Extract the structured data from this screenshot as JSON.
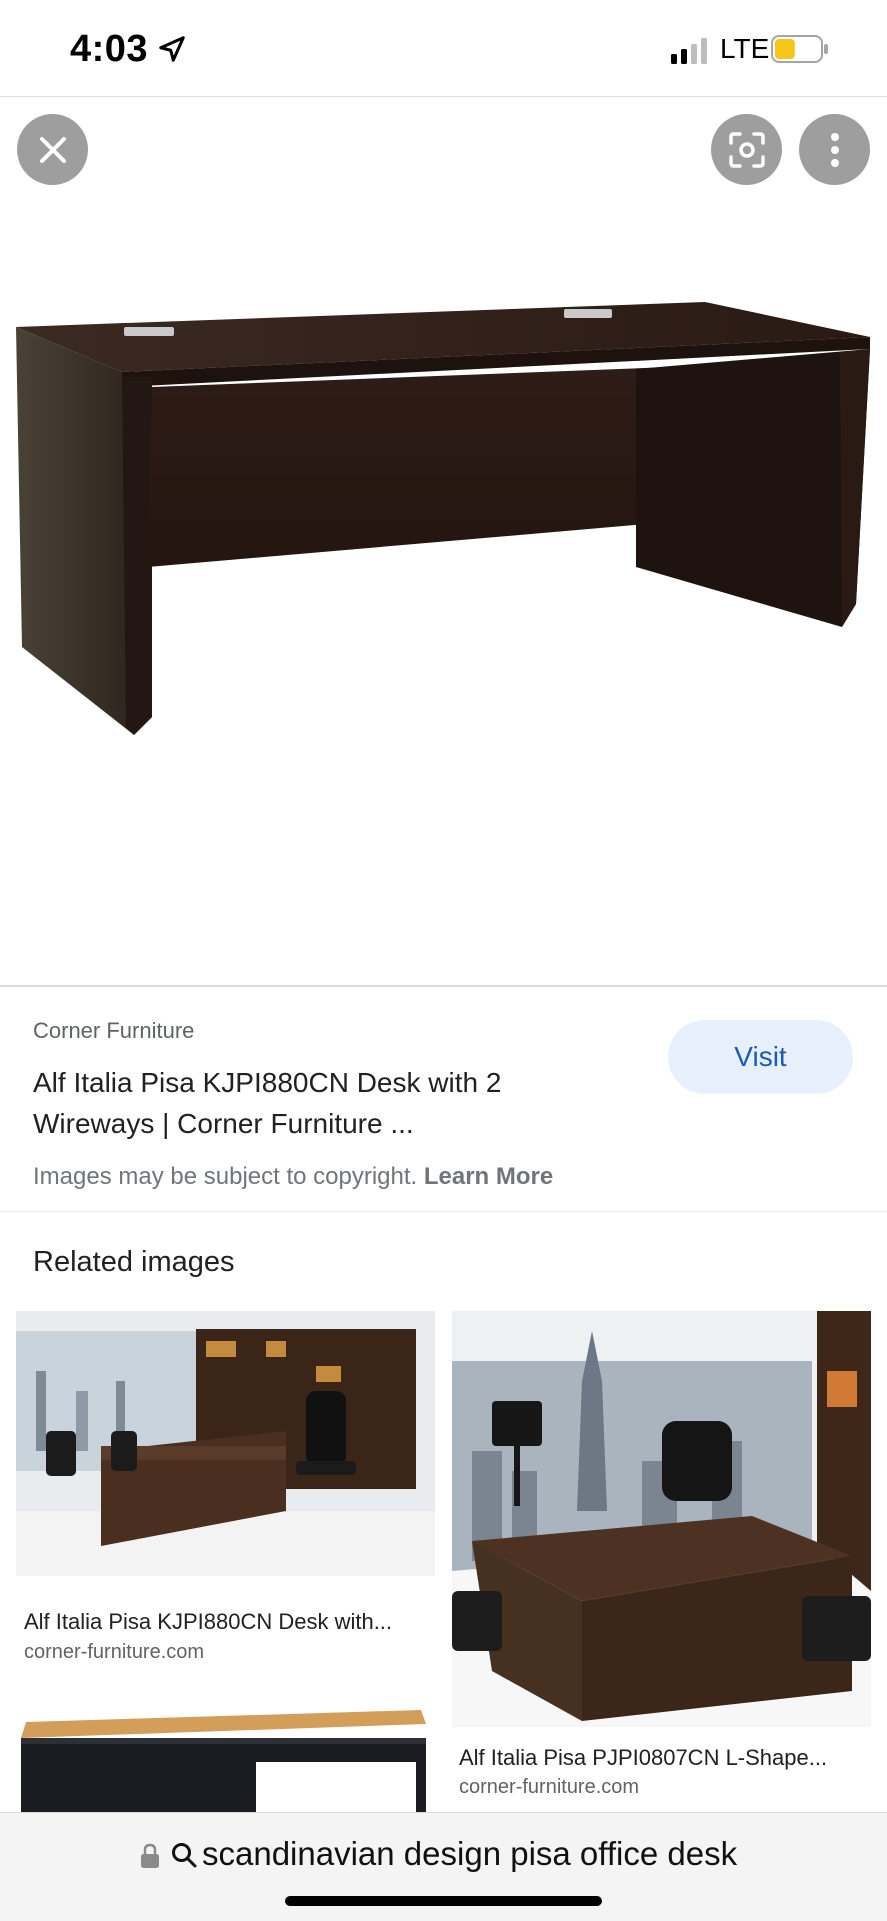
{
  "status_bar": {
    "time": "4:03",
    "network": "LTE",
    "battery_level": 0.45,
    "battery_color": "#f5c518"
  },
  "viewer": {
    "close_icon": "close-icon",
    "lens_icon": "lens-icon",
    "more_icon": "more-vert-icon",
    "image_subject": "desk-image"
  },
  "result": {
    "source": "Corner Furniture",
    "title": "Alf Italia Pisa KJPI880CN Desk with 2 Wireways | Corner Furniture ...",
    "visit_label": "Visit",
    "copyright_text": "Images may be subject to copyright.",
    "learn_more": "Learn More"
  },
  "related": {
    "heading": "Related images",
    "items": [
      {
        "title": "Alf Italia Pisa KJPI880CN Desk with...",
        "site": "corner-furniture.com"
      },
      {
        "title": "Alf Italia Pisa PJPI0807CN L-Shape...",
        "site": "corner-furniture.com"
      }
    ]
  },
  "url_bar": {
    "query": "scandinavian design pisa office desk"
  },
  "colors": {
    "accent": "#1a5bb6",
    "visit_bg": "#e8f0fe",
    "button_gray": "#9e9e9e"
  }
}
